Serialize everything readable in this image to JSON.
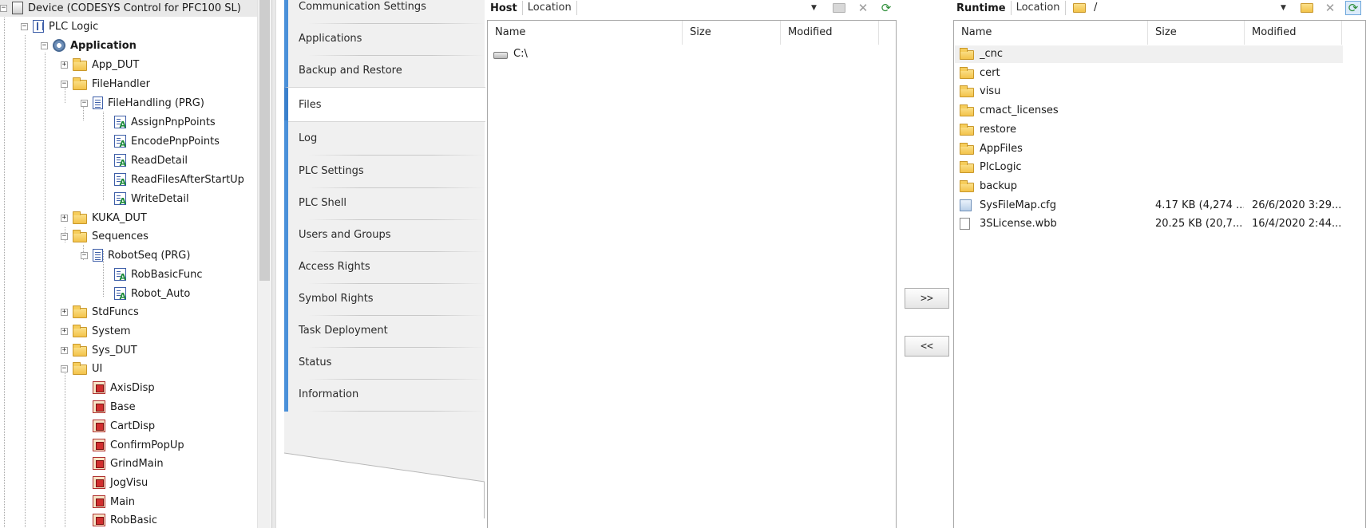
{
  "tree": {
    "nodes": [
      {
        "label": "Device (CODESYS Control for PFC100 SL)",
        "icon": "device-icon",
        "glyph": "−",
        "bold": false
      },
      {
        "label": "PLC Logic",
        "icon": "plc-logic-icon",
        "glyph": "−",
        "bold": false
      },
      {
        "label": "Application",
        "icon": "gear-icon",
        "glyph": "−",
        "bold": true
      },
      {
        "label": "App_DUT",
        "icon": "folder-icon",
        "glyph": "+",
        "bold": false
      },
      {
        "label": "FileHandler",
        "icon": "folder-icon",
        "glyph": "−",
        "bold": false
      },
      {
        "label": "FileHandling (PRG)",
        "icon": "program-icon",
        "glyph": "−",
        "bold": false
      },
      {
        "label": "AssignPnpPoints",
        "icon": "action-icon",
        "glyph": "",
        "bold": false
      },
      {
        "label": "EncodePnpPoints",
        "icon": "action-icon",
        "glyph": "",
        "bold": false
      },
      {
        "label": "ReadDetail",
        "icon": "action-icon",
        "glyph": "",
        "bold": false
      },
      {
        "label": "ReadFilesAfterStartUp",
        "icon": "action-icon",
        "glyph": "",
        "bold": false
      },
      {
        "label": "WriteDetail",
        "icon": "action-icon",
        "glyph": "",
        "bold": false
      },
      {
        "label": "KUKA_DUT",
        "icon": "folder-icon",
        "glyph": "+",
        "bold": false
      },
      {
        "label": "Sequences",
        "icon": "folder-icon",
        "glyph": "−",
        "bold": false
      },
      {
        "label": "RobotSeq (PRG)",
        "icon": "program-icon",
        "glyph": "−",
        "bold": false
      },
      {
        "label": "RobBasicFunc",
        "icon": "action-icon",
        "glyph": "",
        "bold": false
      },
      {
        "label": "Robot_Auto",
        "icon": "action-icon",
        "glyph": "",
        "bold": false
      },
      {
        "label": "StdFuncs",
        "icon": "folder-icon",
        "glyph": "+",
        "bold": false
      },
      {
        "label": "System",
        "icon": "folder-icon",
        "glyph": "+",
        "bold": false
      },
      {
        "label": "Sys_DUT",
        "icon": "folder-icon",
        "glyph": "+",
        "bold": false
      },
      {
        "label": "UI",
        "icon": "folder-icon",
        "glyph": "−",
        "bold": false
      },
      {
        "label": "AxisDisp",
        "icon": "visualization-icon",
        "glyph": "",
        "bold": false
      },
      {
        "label": "Base",
        "icon": "visualization-icon",
        "glyph": "",
        "bold": false
      },
      {
        "label": "CartDisp",
        "icon": "visualization-icon",
        "glyph": "",
        "bold": false
      },
      {
        "label": "ConfirmPopUp",
        "icon": "visualization-icon",
        "glyph": "",
        "bold": false
      },
      {
        "label": "GrindMain",
        "icon": "visualization-icon",
        "glyph": "",
        "bold": false
      },
      {
        "label": "JogVisu",
        "icon": "visualization-icon",
        "glyph": "",
        "bold": false
      },
      {
        "label": "Main",
        "icon": "visualization-icon",
        "glyph": "",
        "bold": false
      },
      {
        "label": "RobBasic",
        "icon": "visualization-icon",
        "glyph": "",
        "bold": false
      }
    ]
  },
  "categories": [
    {
      "label": "Communication Settings",
      "active": false
    },
    {
      "label": "Applications",
      "active": false
    },
    {
      "label": "Backup and Restore",
      "active": false
    },
    {
      "label": "Files",
      "active": true
    },
    {
      "label": "Log",
      "active": false
    },
    {
      "label": "PLC Settings",
      "active": false
    },
    {
      "label": "PLC Shell",
      "active": false
    },
    {
      "label": "Users and Groups",
      "active": false
    },
    {
      "label": "Access Rights",
      "active": false
    },
    {
      "label": "Symbol Rights",
      "active": false
    },
    {
      "label": "Task Deployment",
      "active": false
    },
    {
      "label": "Status",
      "active": false
    },
    {
      "label": "Information",
      "active": false
    }
  ],
  "host": {
    "title": "Host",
    "location_label": "Location",
    "location_value": "",
    "columns": [
      "Name",
      "Size",
      "Modified"
    ],
    "rows": [
      {
        "name": "C:\\",
        "icon": "drive-icon",
        "size": "",
        "modified": ""
      }
    ]
  },
  "runtime": {
    "title": "Runtime",
    "location_label": "Location",
    "location_value": "/",
    "columns": [
      "Name",
      "Size",
      "Modified"
    ],
    "rows": [
      {
        "name": "_cnc",
        "icon": "folder-icon",
        "size": "",
        "modified": "",
        "selected": true
      },
      {
        "name": "cert",
        "icon": "folder-icon",
        "size": "",
        "modified": ""
      },
      {
        "name": "visu",
        "icon": "folder-icon",
        "size": "",
        "modified": ""
      },
      {
        "name": "cmact_licenses",
        "icon": "folder-icon",
        "size": "",
        "modified": ""
      },
      {
        "name": "restore",
        "icon": "folder-icon",
        "size": "",
        "modified": ""
      },
      {
        "name": "AppFiles",
        "icon": "folder-icon",
        "size": "",
        "modified": ""
      },
      {
        "name": "PlcLogic",
        "icon": "folder-icon",
        "size": "",
        "modified": ""
      },
      {
        "name": "backup",
        "icon": "folder-icon",
        "size": "",
        "modified": ""
      },
      {
        "name": "SysFileMap.cfg",
        "icon": "config-file-icon",
        "size": "4.17 KB (4,274 ...",
        "modified": "26/6/2020 3:29..."
      },
      {
        "name": "3SLicense.wbb",
        "icon": "file-icon",
        "size": "20.25 KB (20,7...",
        "modified": "16/4/2020 2:44..."
      }
    ]
  },
  "transfer": {
    "to_runtime": ">>",
    "to_host": "<<"
  },
  "colors": {
    "accent": "#4a90d9",
    "category_bg": "#f0f0f0",
    "refresh": "#2f8f3a"
  }
}
